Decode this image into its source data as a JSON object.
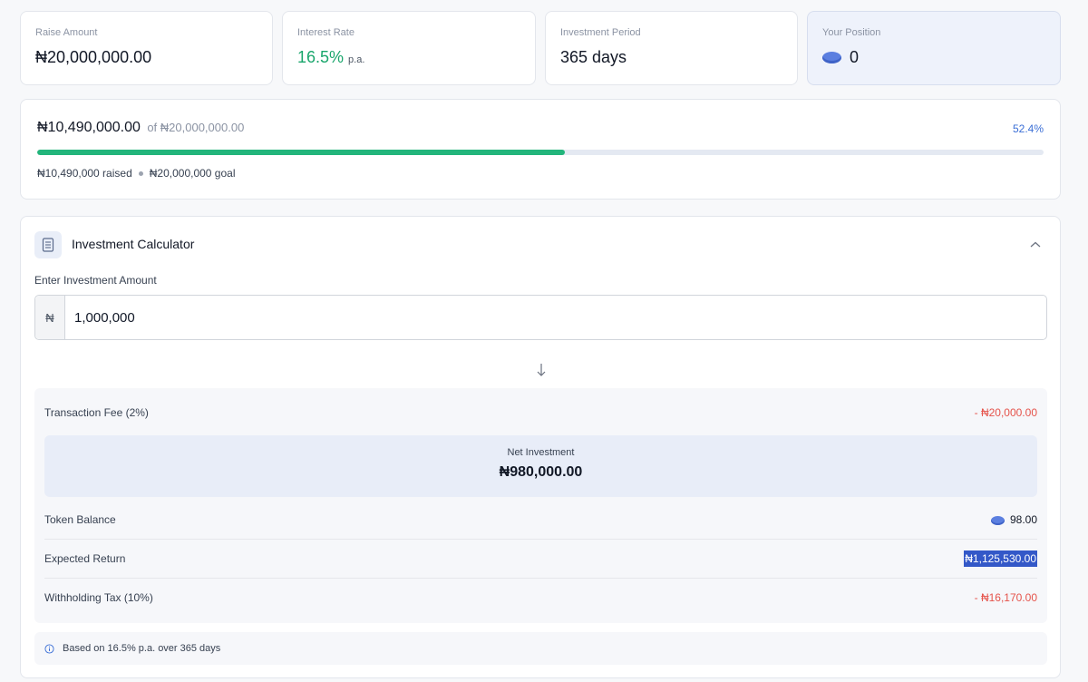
{
  "stats": [
    {
      "label": "Raise Amount",
      "value": "₦20,000,000.00"
    },
    {
      "label": "Interest Rate",
      "value": "16.5%",
      "suffix": "p.a."
    },
    {
      "label": "Investment Period",
      "value": "365 days"
    },
    {
      "label": "Your Position",
      "value": "0",
      "icon": "token-coin-icon"
    }
  ],
  "progress": {
    "raised": "₦10,490,000.00",
    "of_goal": "of ₦20,000,000.00",
    "percent_label": "52.4%",
    "percent_value": 52.4,
    "raised_short": "₦10,490,000 raised",
    "goal_short": "₦20,000,000 goal"
  },
  "calculator": {
    "title": "Investment Calculator",
    "input_label": "Enter Investment Amount",
    "currency_symbol": "₦",
    "amount_value": "1,000,000",
    "fee": {
      "label": "Transaction Fee (2%)",
      "value": "- ₦20,000.00"
    },
    "net": {
      "label": "Net Investment",
      "value": "₦980,000.00"
    },
    "token": {
      "label": "Token Balance",
      "value": "98.00"
    },
    "expected": {
      "label": "Expected Return",
      "value": "₦1,125,530.00"
    },
    "tax": {
      "label": "Withholding Tax (10%)",
      "value": "- ₦16,170.00"
    },
    "note": "Based on 16.5% p.a. over 365 days"
  },
  "colors": {
    "accent_blue": "#3b6fd6",
    "progress_green": "#22b57b",
    "negative_red": "#e5534b",
    "rate_green": "#1aa66c"
  }
}
